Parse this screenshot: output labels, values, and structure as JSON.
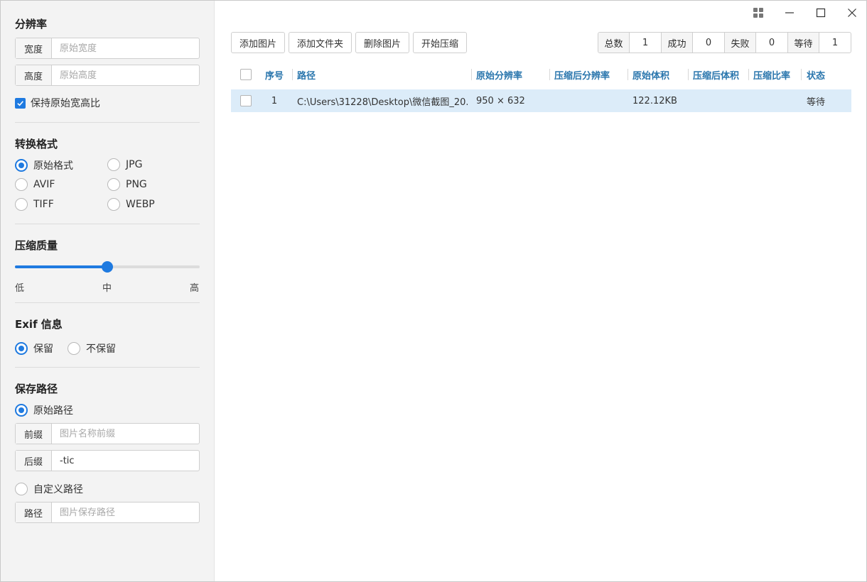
{
  "sidebar": {
    "resolution": {
      "title": "分辨率",
      "width_label": "宽度",
      "width_placeholder": "原始宽度",
      "height_label": "高度",
      "height_placeholder": "原始高度",
      "keep_ratio_label": "保持原始宽高比",
      "keep_ratio_checked": true
    },
    "format": {
      "title": "转换格式",
      "options": [
        "原始格式",
        "JPG",
        "AVIF",
        "PNG",
        "TIFF",
        "WEBP"
      ],
      "selected": "原始格式"
    },
    "quality": {
      "title": "压缩质量",
      "low": "低",
      "mid": "中",
      "high": "高",
      "value": 0.5
    },
    "exif": {
      "title": "Exif 信息",
      "keep": "保留",
      "discard": "不保留",
      "selected": "保留"
    },
    "save_path": {
      "title": "保存路径",
      "original_path_label": "原始路径",
      "prefix_label": "前缀",
      "prefix_placeholder": "图片名称前缀",
      "suffix_label": "后缀",
      "suffix_value": "-tic",
      "custom_path_label": "自定义路径",
      "path_label": "路径",
      "path_placeholder": "图片保存路径",
      "selected": "原始路径"
    }
  },
  "toolbar": {
    "add_images": "添加图片",
    "add_folder": "添加文件夹",
    "delete_images": "删除图片",
    "start_compress": "开始压缩"
  },
  "stats": {
    "total_label": "总数",
    "total": "1",
    "success_label": "成功",
    "success": "0",
    "fail_label": "失败",
    "fail": "0",
    "waiting_label": "等待",
    "waiting": "1"
  },
  "table": {
    "headers": {
      "index": "序号",
      "path": "路径",
      "orig_res": "原始分辨率",
      "new_res": "压缩后分辨率",
      "orig_size": "原始体积",
      "new_size": "压缩后体积",
      "ratio": "压缩比率",
      "status": "状态"
    },
    "rows": [
      {
        "index": "1",
        "path": "C:\\Users\\31228\\Desktop\\微信截图_20...",
        "orig_res": "950 × 632",
        "new_res": "",
        "orig_size": "122.12KB",
        "new_size": "",
        "ratio": "",
        "status": "等待"
      }
    ]
  },
  "colors": {
    "accent": "#1f7ae0",
    "header_text": "#2a76ad",
    "selected_row": "#dcecf9",
    "sidebar_bg": "#f3f3f3"
  }
}
